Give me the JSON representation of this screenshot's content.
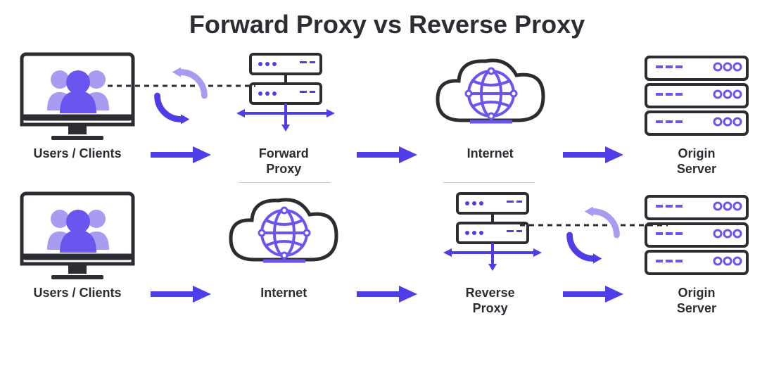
{
  "title": "Forward Proxy vs Reverse Proxy",
  "labels": {
    "users": "Users / Clients",
    "forward_proxy": "Forward\nProxy",
    "reverse_proxy": "Reverse\nProxy",
    "internet": "Internet",
    "origin": "Origin\nServer"
  },
  "colors": {
    "dark": "#2b2d33",
    "accent": "#4f3ee8",
    "accent_light": "#a89cf0"
  },
  "rows": [
    {
      "nodes": [
        "users",
        "forward_proxy",
        "internet",
        "origin"
      ],
      "sync_between": [
        0,
        1
      ]
    },
    {
      "nodes": [
        "users",
        "internet",
        "reverse_proxy",
        "origin"
      ],
      "sync_between": [
        2,
        3
      ]
    }
  ]
}
